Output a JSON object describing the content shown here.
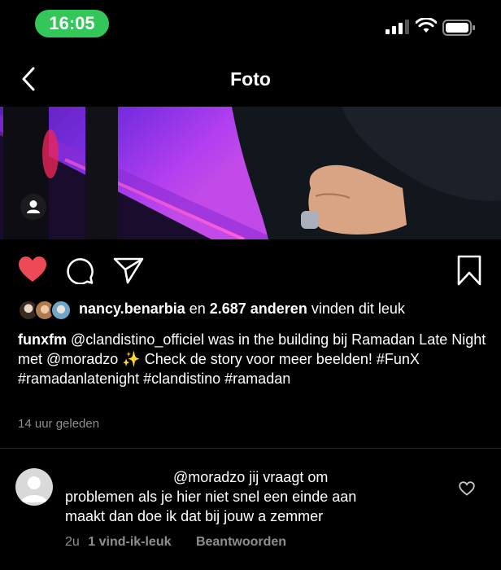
{
  "status_bar": {
    "time": "16:05",
    "time_pill_color": "#33c759",
    "icons": [
      "signal-icon",
      "wifi-icon",
      "battery-icon"
    ]
  },
  "header": {
    "title": "Foto",
    "back_icon": "chevron-left-icon"
  },
  "post": {
    "actions": {
      "like_icon": "heart-filled-icon",
      "like_color": "#ed4956",
      "comment_icon": "comment-icon",
      "share_icon": "paper-plane-icon",
      "save_icon": "bookmark-icon"
    },
    "likes": {
      "first_user": "nancy.benarbia",
      "connector": " en ",
      "count": "2.687 anderen",
      "suffix": " vinden dit leuk"
    },
    "caption": {
      "username": "funxfm",
      "text": " @clandistino_officiel was in the building bij Ramadan Late Night met @moradzo ✨ Check de story voor meer beelden! #FunX #ramadanlatenight #clandistino #ramadan"
    },
    "timestamp": "14 uur geleden"
  },
  "comment": {
    "line1": "@moradzo jij vraagt om",
    "line2": "problemen als je hier niet snel een einde aan",
    "line3": "maakt dan doe ik dat bij jouw a zemmer",
    "time": "2u",
    "likes": "1 vind-ik-leuk",
    "reply": "Beantwoorden"
  }
}
